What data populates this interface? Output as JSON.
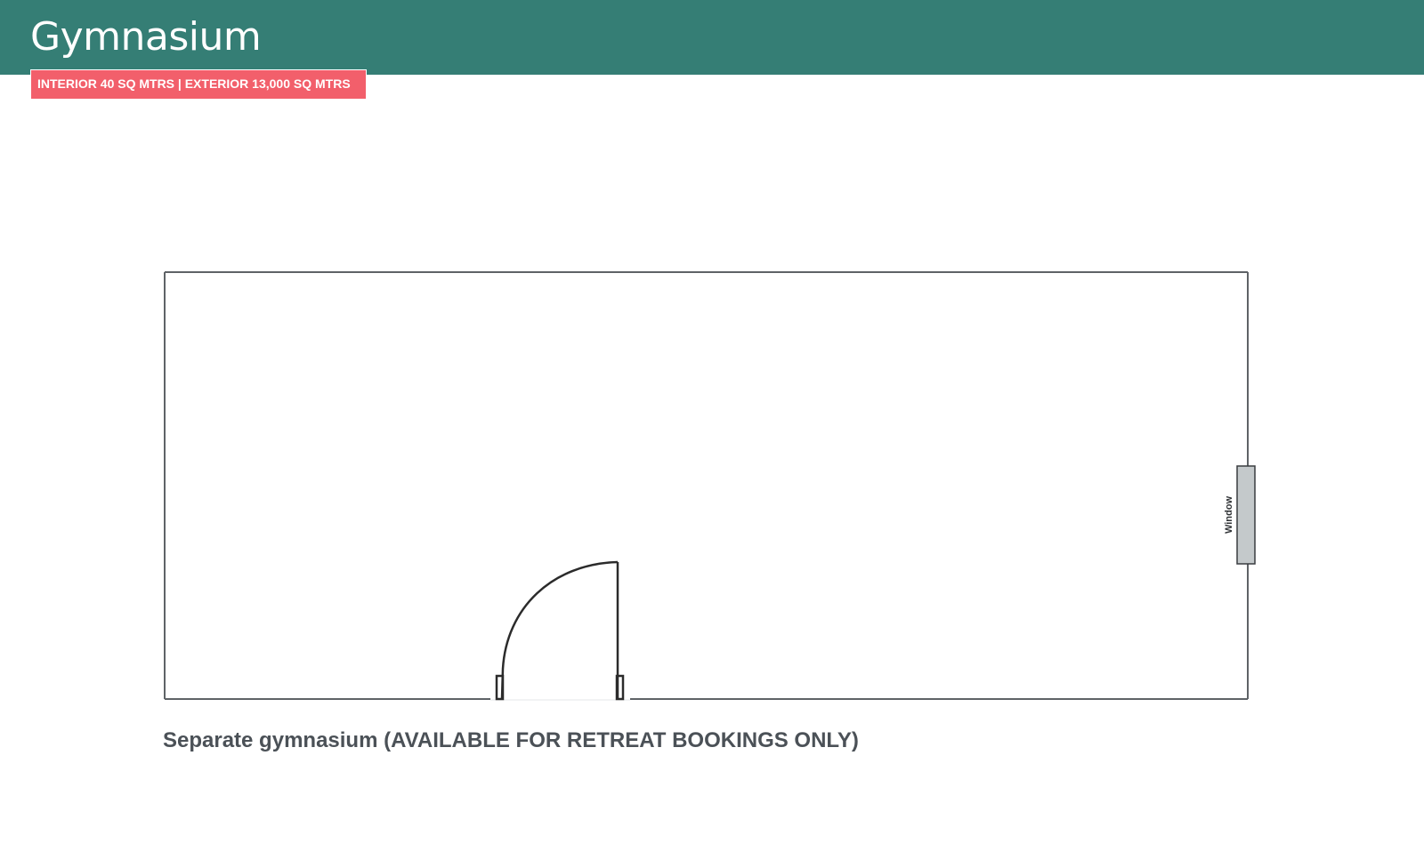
{
  "header": {
    "title": "Gymnasium",
    "area_badge": "INTERIOR 40 SQ MTRS | EXTERIOR 13,000 SQ MTRS"
  },
  "floorplan": {
    "window_label": "Window"
  },
  "caption": {
    "text": "Separate gymnasium (AVAILABLE FOR RETREAT BOOKINGS ONLY)"
  },
  "colors": {
    "header_bg": "#357e75",
    "badge_bg": "#f25f6b",
    "wall_stroke": "#5f6367",
    "door_stroke": "#2b2b2b",
    "window_fill": "#c4c9cb",
    "caption_text": "#4b5157"
  }
}
